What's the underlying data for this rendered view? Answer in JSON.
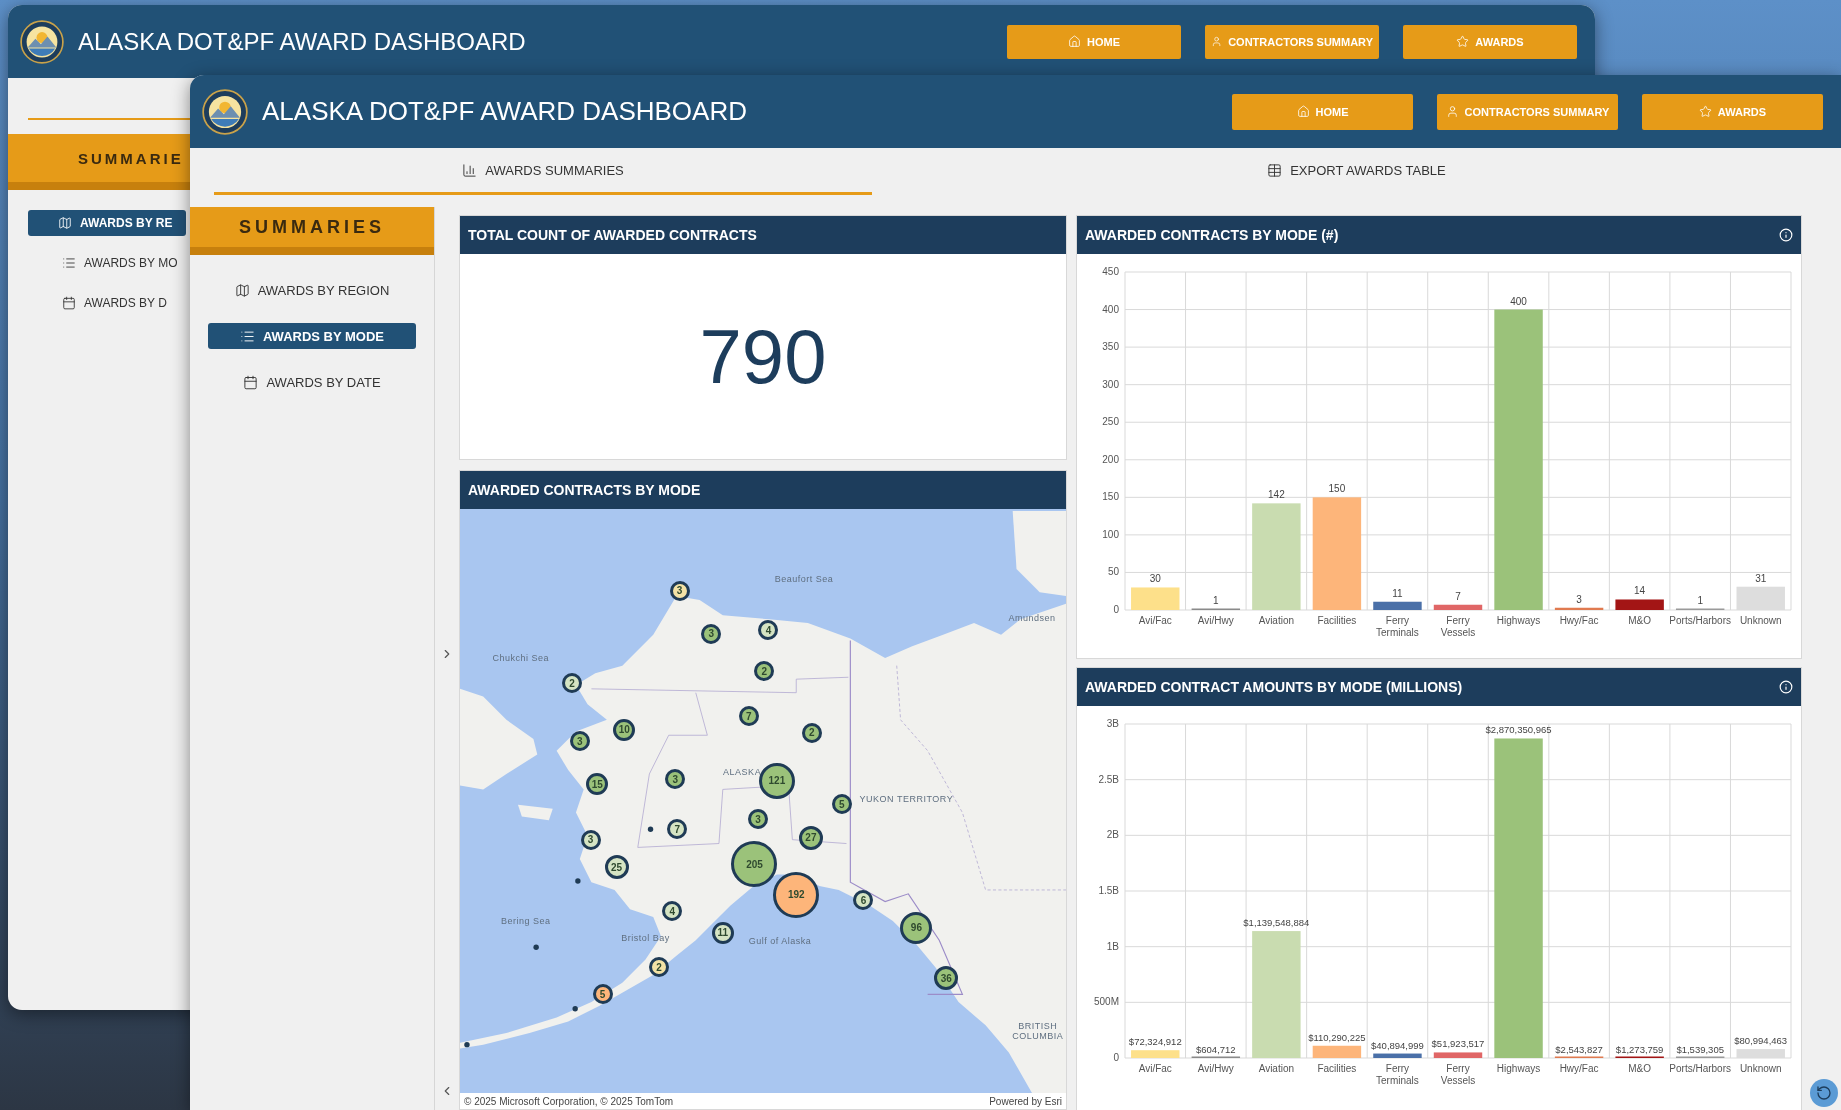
{
  "back_window": {
    "title": "ALASKA DOT&PF AWARD DASHBOARD",
    "nav_buttons": [
      {
        "label": "HOME"
      },
      {
        "label": "CONTRACTORS SUMMARY"
      },
      {
        "label": "AWARDS"
      }
    ],
    "sidebar": {
      "title": "SUMMARIE",
      "items": [
        {
          "label": "AWARDS BY RE",
          "selected": true
        },
        {
          "label": "AWARDS BY MO",
          "selected": false
        },
        {
          "label": "AWARDS BY D",
          "selected": false
        }
      ]
    }
  },
  "front_window": {
    "title": "ALASKA DOT&PF AWARD DASHBOARD",
    "nav_buttons": [
      {
        "label": "HOME"
      },
      {
        "label": "CONTRACTORS SUMMARY"
      },
      {
        "label": "AWARDS"
      }
    ],
    "tabs": [
      {
        "label": "AWARDS SUMMARIES",
        "selected": true
      },
      {
        "label": "EXPORT AWARDS TABLE",
        "selected": false
      }
    ],
    "sidebar": {
      "title": "SUMMARIES",
      "items": [
        {
          "label": "AWARDS BY REGION",
          "selected": false
        },
        {
          "label": "AWARDS BY MODE",
          "selected": true
        },
        {
          "label": "AWARDS BY DATE",
          "selected": false
        }
      ]
    },
    "total_card": {
      "title": "TOTAL COUNT OF AWARDED CONTRACTS",
      "value": "790"
    },
    "map_card": {
      "title": "AWARDED CONTRACTS BY MODE",
      "labels": [
        "Beaufort Sea",
        "Amundsen",
        "Chukchi Sea",
        "ALASKA",
        "YUKON TERRITORY",
        "Bering Sea",
        "Bristol Bay",
        "Gulf of Alaska",
        "BRITISH COLUMBIA"
      ],
      "clusters": [
        {
          "count": "3",
          "color": "#f3e2a6"
        },
        {
          "count": "3",
          "color": "#9bc27a"
        },
        {
          "count": "4",
          "color": "#d5e4c3"
        },
        {
          "count": "2",
          "color": "#d5e4c3"
        },
        {
          "count": "2",
          "color": "#9bc27a"
        },
        {
          "count": "7",
          "color": "#9bc27a"
        },
        {
          "count": "2",
          "color": "#9bc27a"
        },
        {
          "count": "10",
          "color": "#9bc27a"
        },
        {
          "count": "3",
          "color": "#9bc27a"
        },
        {
          "count": "3",
          "color": "#9bc27a"
        },
        {
          "count": "121",
          "color": "#9bc27a"
        },
        {
          "count": "15",
          "color": "#9bc27a"
        },
        {
          "count": "5",
          "color": "#9bc27a"
        },
        {
          "count": "3",
          "color": "#9bc27a"
        },
        {
          "count": "7",
          "color": "#d5e4c3"
        },
        {
          "count": "3",
          "color": "#d5e4c3"
        },
        {
          "count": "27",
          "color": "#9bc27a"
        },
        {
          "count": "25",
          "color": "#d5e4c3"
        },
        {
          "count": "205",
          "color": "#9bc27a"
        },
        {
          "count": "192",
          "color": "#fdb57a"
        },
        {
          "count": "6",
          "color": "#d5e4c3"
        },
        {
          "count": "4",
          "color": "#d5e4c3"
        },
        {
          "count": "96",
          "color": "#9bc27a"
        },
        {
          "count": "11",
          "color": "#d5e4c3"
        },
        {
          "count": "2",
          "color": "#f3e2a6"
        },
        {
          "count": "36",
          "color": "#9bc27a"
        },
        {
          "count": "5",
          "color": "#fdb57a"
        }
      ],
      "attribution": "© 2025 Microsoft Corporation, © 2025 TomTom",
      "credit": "Powered by Esri"
    },
    "charts": [
      {
        "title": "AWARDED CONTRACTS BY MODE (#)",
        "chart_data": {
          "type": "bar",
          "series": [
            {
              "name": "Avi/Fac",
              "color": "#fde08a",
              "values": [
                30,
                null,
                null,
                null,
                null,
                null,
                null,
                null,
                null,
                null,
                null
              ]
            },
            {
              "name": "Avi/Hwy",
              "color": "#8a8a8a",
              "values": [
                null,
                1,
                null,
                null,
                null,
                null,
                null,
                null,
                null,
                null,
                null
              ]
            },
            {
              "name": "Aviation",
              "color": "#c9dcb0",
              "values": [
                null,
                null,
                142,
                null,
                null,
                null,
                null,
                null,
                null,
                null,
                null
              ]
            },
            {
              "name": "Facilities",
              "color": "#fdb57a",
              "values": [
                null,
                null,
                null,
                150,
                null,
                null,
                null,
                null,
                null,
                null,
                null
              ]
            },
            {
              "name": "Ferry Terminals",
              "color": "#4a70a8",
              "values": [
                null,
                null,
                null,
                null,
                11,
                null,
                null,
                null,
                null,
                null,
                null
              ]
            },
            {
              "name": "Ferry Vessels",
              "color": "#e06666",
              "values": [
                null,
                null,
                null,
                null,
                null,
                7,
                null,
                null,
                null,
                null,
                null
              ]
            },
            {
              "name": "Highways",
              "color": "#9bc27a",
              "values": [
                null,
                null,
                null,
                null,
                null,
                null,
                400,
                null,
                null,
                null,
                null
              ]
            },
            {
              "name": "Hwy/Fac",
              "color": "#e07a50",
              "values": [
                null,
                null,
                null,
                null,
                null,
                null,
                null,
                3,
                null,
                null,
                null
              ]
            },
            {
              "name": "M&O",
              "color": "#a31515",
              "values": [
                null,
                null,
                null,
                null,
                null,
                null,
                null,
                null,
                14,
                null,
                null
              ]
            },
            {
              "name": "Ports/Harbors",
              "color": "#9a9a9a",
              "values": [
                null,
                null,
                null,
                null,
                null,
                null,
                null,
                null,
                null,
                1,
                null
              ]
            },
            {
              "name": "Unknown",
              "color": "#dddddd",
              "values": [
                null,
                null,
                null,
                null,
                null,
                null,
                null,
                null,
                null,
                null,
                31
              ]
            }
          ],
          "stacked": true,
          "grid": true,
          "ylim": [
            0,
            450
          ],
          "yticks": [
            0,
            50,
            100,
            150,
            200,
            250,
            300,
            350,
            400,
            450
          ],
          "data_labels": true
        }
      },
      {
        "title": "AWARDED CONTRACT AMOUNTS BY MODE (MILLIONS)",
        "chart_data": {
          "type": "bar",
          "series": [
            {
              "name": "Avi/Fac",
              "color": "#fde08a",
              "values": [
                70000000,
                null,
                null,
                null,
                null,
                null,
                null,
                null,
                null,
                null,
                null
              ]
            },
            {
              "name": "Avi/Hwy",
              "color": "#8a8a8a",
              "values": [
                null,
                0,
                null,
                null,
                null,
                null,
                null,
                null,
                null,
                null,
                null
              ]
            },
            {
              "name": "Aviation",
              "color": "#c9dcb0",
              "values": [
                null,
                null,
                1140000000,
                null,
                null,
                null,
                null,
                null,
                null,
                null,
                null
              ]
            },
            {
              "name": "Facilities",
              "color": "#fdb57a",
              "values": [
                null,
                null,
                null,
                110000000,
                null,
                null,
                null,
                null,
                null,
                null,
                null
              ]
            },
            {
              "name": "Ferry Terminals",
              "color": "#4a70a8",
              "values": [
                null,
                null,
                null,
                null,
                40000000,
                null,
                null,
                null,
                null,
                null,
                null
              ]
            },
            {
              "name": "Ferry Vessels",
              "color": "#e06666",
              "values": [
                null,
                null,
                null,
                null,
                null,
                50000000,
                null,
                null,
                null,
                null,
                null
              ]
            },
            {
              "name": "Highways",
              "color": "#9bc27a",
              "values": [
                null,
                null,
                null,
                null,
                null,
                null,
                2870000000,
                null,
                null,
                null,
                null
              ]
            },
            {
              "name": "Hwy/Fac",
              "color": "#e07a50",
              "values": [
                null,
                null,
                null,
                null,
                null,
                null,
                null,
                0,
                null,
                null,
                null
              ]
            },
            {
              "name": "M&O",
              "color": "#a31515",
              "values": [
                null,
                null,
                null,
                null,
                null,
                null,
                null,
                null,
                0,
                null,
                null
              ]
            },
            {
              "name": "Ports/Harbors",
              "color": "#9a9a9a",
              "values": [
                null,
                null,
                null,
                null,
                null,
                null,
                null,
                null,
                null,
                0,
                null
              ]
            },
            {
              "name": "Unknown",
              "color": "#dddddd",
              "values": [
                null,
                null,
                null,
                null,
                null,
                null,
                null,
                null,
                null,
                null,
                80000000
              ]
            }
          ],
          "stacked": true,
          "grid": true,
          "ylim": [
            0,
            3000000000
          ],
          "yticks": [
            {
              "value": 0,
              "label": "0"
            },
            {
              "value": 500000000,
              "label": "500M"
            },
            {
              "value": 1000000000,
              "label": "1B"
            },
            {
              "value": 1500000000,
              "label": "1.5B"
            },
            {
              "value": 2000000000,
              "label": "2B"
            },
            {
              "value": 2500000000,
              "label": "2.5B"
            },
            {
              "value": 3000000000,
              "label": "3B"
            }
          ],
          "value_labels": [
            "$72,324,912",
            "$604,712",
            "$1,139,548,884",
            "$110,290,225",
            "$40,894,999",
            "$51,923,517",
            "$2,870,350,965",
            "$2,543,827",
            "$1,273,759",
            "$1,539,305",
            "$80,994,463"
          ]
        }
      }
    ]
  }
}
